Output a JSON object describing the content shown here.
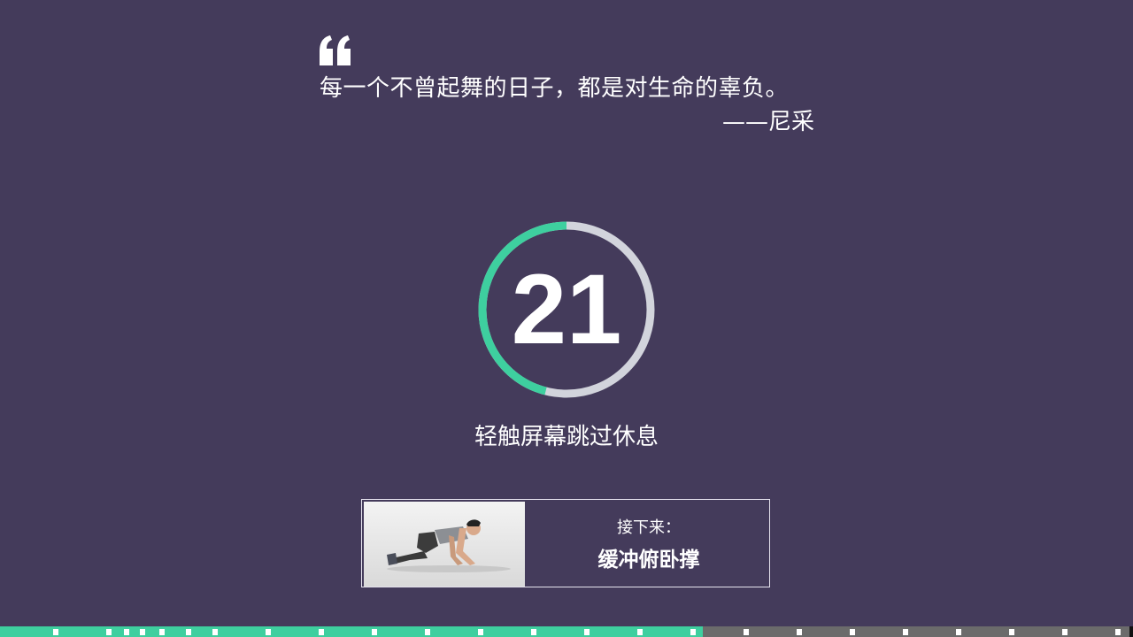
{
  "quote": {
    "text": "每一个不曾起舞的日子，都是对生命的辜负。",
    "author": "——尼采"
  },
  "timer": {
    "remaining": "21",
    "elapsed_fraction": 0.46
  },
  "skip_hint": "轻触屏幕跳过休息",
  "next_exercise": {
    "label": "接下来：",
    "name": "缓冲俯卧撑",
    "thumbnail_icon": "person-pushup-image"
  },
  "workout_progress": {
    "completed_fraction": 0.62
  },
  "colors": {
    "background": "#443b5b",
    "accent": "#3ecf9f",
    "ring_track": "#d2d4dc",
    "progress_track": "#6b6b6b"
  }
}
